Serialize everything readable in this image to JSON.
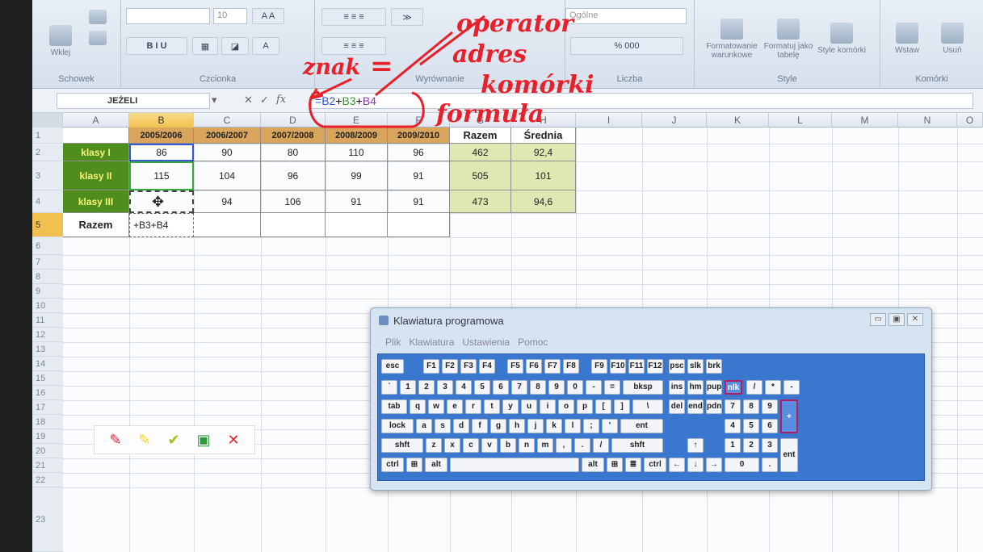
{
  "ribbon": {
    "paste_label": "Wklej",
    "clipboard_label": "Schowek",
    "font_size": "10",
    "font_group_label": "Czcionka",
    "alignment_label": "Wyrównanie",
    "number_format": "Ogólne",
    "number_label": "Liczba",
    "percent_label": "% 000",
    "cond_format_label": "Formatowanie warunkowe",
    "format_table_label": "Formatuj jako tabelę",
    "cell_styles_label": "Style komórki",
    "styles_label": "Style",
    "insert_label": "Wstaw",
    "delete_label": "Usuń",
    "cells_label": "Komórki"
  },
  "formula_bar": {
    "name_box": "JEŻELI",
    "formula_eq": "=",
    "formula_b2": "B2",
    "formula_plus1": "+",
    "formula_b3": "B3",
    "formula_plus2": "+",
    "formula_b4": "B4"
  },
  "columns": [
    "A",
    "B",
    "C",
    "D",
    "E",
    "F",
    "G",
    "H",
    "I",
    "J",
    "K",
    "L",
    "M",
    "N",
    "O"
  ],
  "rows": [
    "1",
    "2",
    "3",
    "4",
    "5",
    "6",
    "7",
    "8",
    "9",
    "10",
    "11",
    "12",
    "13",
    "14",
    "15",
    "16",
    "17",
    "18",
    "19",
    "20",
    "21",
    "22",
    "23"
  ],
  "table": {
    "headers": [
      "2005/2006",
      "2006/2007",
      "2007/2008",
      "2008/2009",
      "2009/2010",
      "Razem",
      "Średnia"
    ],
    "row_labels": [
      "klasy I",
      "klasy II",
      "klasy III",
      "Razem"
    ],
    "data": [
      [
        "86",
        "90",
        "80",
        "110",
        "96",
        "462",
        "92,4"
      ],
      [
        "115",
        "104",
        "96",
        "99",
        "91",
        "505",
        "101"
      ],
      [
        "",
        "94",
        "106",
        "91",
        "91",
        "473",
        "94,6"
      ]
    ],
    "editing_formula": "+B3+B4"
  },
  "annotations": {
    "operator": "operator",
    "znak": "znak",
    "znak_eq": "=",
    "adres": "adres",
    "komorki": "komórki",
    "formula": "formuła"
  },
  "osk": {
    "title": "Klawiatura programowa",
    "menu": [
      "Plik",
      "Klawiatura",
      "Ustawienia",
      "Pomoc"
    ],
    "win_min": "▭",
    "win_max": "▣",
    "win_close": "✕"
  },
  "pen_toolbar": {
    "pen_color": "#e8202a",
    "highlighter_color": "#f0d020",
    "eraser_color": "#a0c020",
    "save_color": "#2a9a3a",
    "close_color": "#e8202a"
  }
}
